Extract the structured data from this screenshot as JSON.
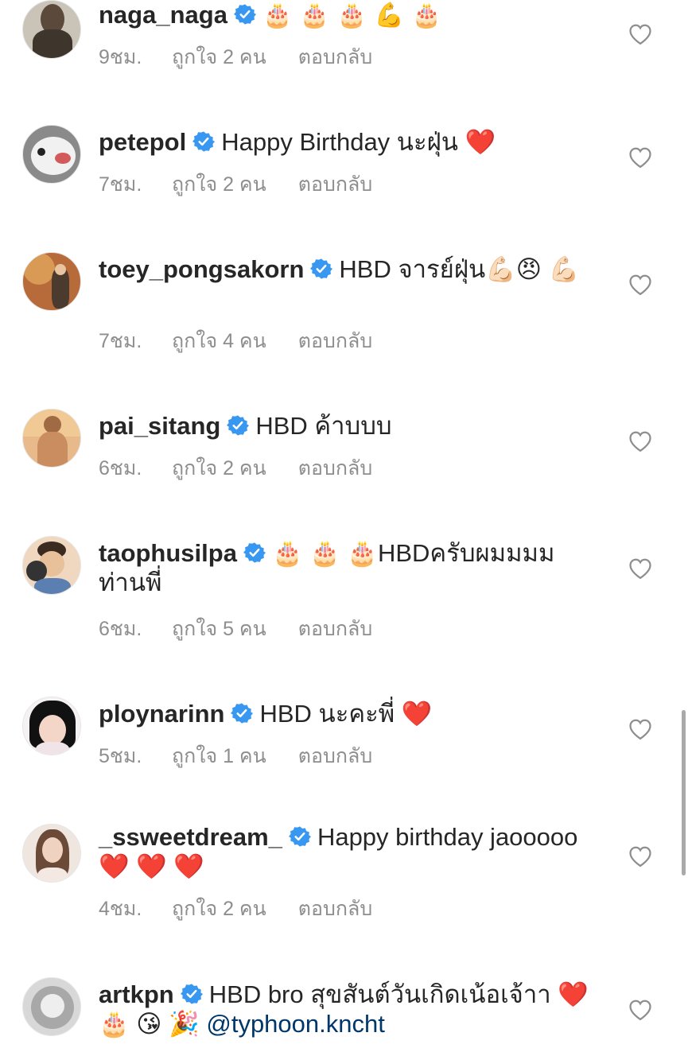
{
  "comments": [
    {
      "username": "naga_naga",
      "text": "🎂 🎂 🎂 💪 🎂",
      "time": "9ชม.",
      "likes": "ถูกใจ 2 คน",
      "reply": "ตอบกลับ"
    },
    {
      "username": "petepol",
      "text": "Happy Birthday นะฝุ่น ❤️",
      "time": "7ชม.",
      "likes": "ถูกใจ 2 คน",
      "reply": "ตอบกลับ"
    },
    {
      "username": "toey_pongsakorn",
      "text": "HBD จารย์ฝุ่น💪🏻😠 💪🏻",
      "time": "7ชม.",
      "likes": "ถูกใจ 4 คน",
      "reply": "ตอบกลับ"
    },
    {
      "username": "pai_sitang",
      "text": "HBD ค้าบบบ",
      "time": "6ชม.",
      "likes": "ถูกใจ 2 คน",
      "reply": "ตอบกลับ"
    },
    {
      "username": "taophusilpa",
      "text": "🎂 🎂 🎂HBDครับผมมมม ท่านพี่",
      "time": "6ชม.",
      "likes": "ถูกใจ 5 คน",
      "reply": "ตอบกลับ"
    },
    {
      "username": "ploynarinn",
      "text": "HBD นะคะพี่ ❤️",
      "time": "5ชม.",
      "likes": "ถูกใจ 1 คน",
      "reply": "ตอบกลับ"
    },
    {
      "username": "_ssweetdream_",
      "text": "Happy birthday jaooooo ❤️ ❤️ ❤️",
      "time": "4ชม.",
      "likes": "ถูกใจ 2 คน",
      "reply": "ตอบกลับ"
    },
    {
      "username": "artkpn",
      "text": "HBD bro สุขสันต์วันเกิดเน้อเจ้าา ❤️ 🎂 😘 🎉 ",
      "mention": "@typhoon.kncht",
      "time": "",
      "likes": "",
      "reply": ""
    }
  ],
  "colors": {
    "verified": "#3897f0",
    "meta": "#8e8e8e",
    "mention": "#00376b",
    "text": "#262626"
  },
  "icons": {
    "verified": "verified-badge-icon",
    "like": "heart-outline-icon"
  }
}
